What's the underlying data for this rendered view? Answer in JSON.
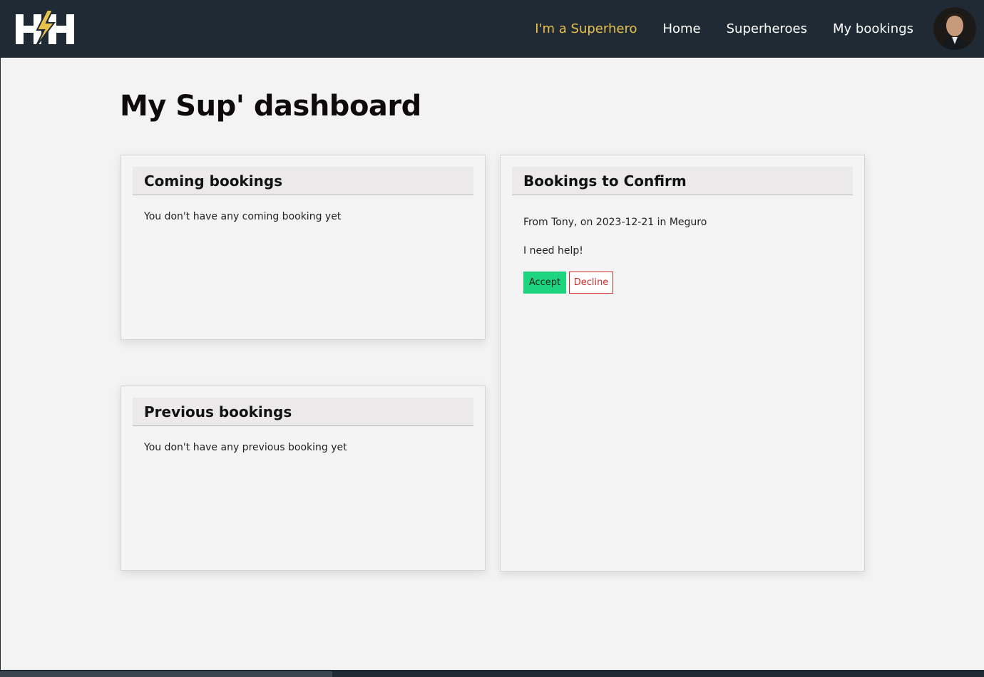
{
  "navbar": {
    "logo_label": "HH",
    "links": [
      {
        "label": "I'm a Superhero"
      },
      {
        "label": "Home"
      },
      {
        "label": "Superheroes"
      },
      {
        "label": "My bookings"
      }
    ],
    "active_color": "#e8c04e",
    "background": "#1f2a34"
  },
  "page": {
    "title": "My Sup' dashboard"
  },
  "coming_bookings": {
    "title": "Coming bookings",
    "empty_text": "You don't have any coming booking yet"
  },
  "previous_bookings": {
    "title": "Previous bookings",
    "empty_text": "You don't have any previous booking yet"
  },
  "bookings_to_confirm": {
    "title": "Bookings to Confirm",
    "items": [
      {
        "summary": "From Tony, on 2023-12-21 in Meguro",
        "message": "I need help!",
        "accept_label": "Accept",
        "decline_label": "Decline"
      }
    ]
  },
  "colors": {
    "accept": "#1fd47e",
    "decline": "#d42a2a"
  }
}
